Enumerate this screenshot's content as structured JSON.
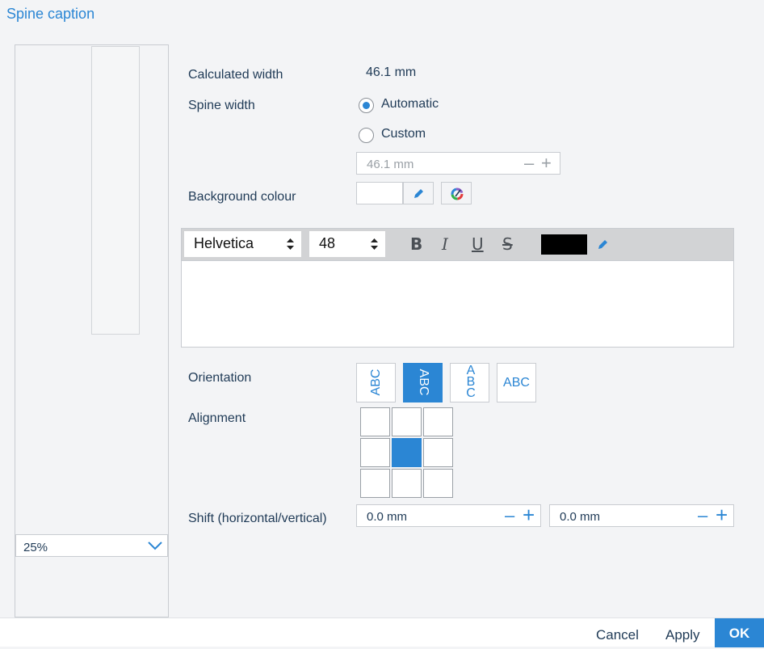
{
  "dialog": {
    "title": "Spine caption"
  },
  "preview": {
    "zoom_value": "25%"
  },
  "form": {
    "calculated_width_label": "Calculated width",
    "calculated_width_value": "46.1 mm",
    "spine_width_label": "Spine width",
    "automatic_label": "Automatic",
    "custom_label": "Custom",
    "spine_width_selected": "Automatic",
    "custom_width_value": "46.1 mm",
    "background_colour_label": "Background colour",
    "background_colour": "#ffffff"
  },
  "text_editor": {
    "font_family": "Helvetica",
    "font_size": "48",
    "bold": "B",
    "italic": "I",
    "underline": "U",
    "strikethrough": "S",
    "text_colour": "#000000",
    "content": ""
  },
  "orientation": {
    "label": "Orientation",
    "options": [
      "ABC",
      "ABC",
      "ABC",
      "ABC"
    ],
    "stacked_letters": [
      "A",
      "B",
      "C"
    ],
    "selected_index": 1
  },
  "alignment": {
    "label": "Alignment",
    "selected": "middle-center"
  },
  "shift": {
    "label": "Shift (horizontal/vertical)",
    "horizontal_value": "0.0 mm",
    "vertical_value": "0.0 mm"
  },
  "footer": {
    "cancel_label": "Cancel",
    "apply_label": "Apply",
    "ok_label": "OK"
  },
  "colors": {
    "accent": "#2b86d4",
    "text": "#1f3a56"
  }
}
